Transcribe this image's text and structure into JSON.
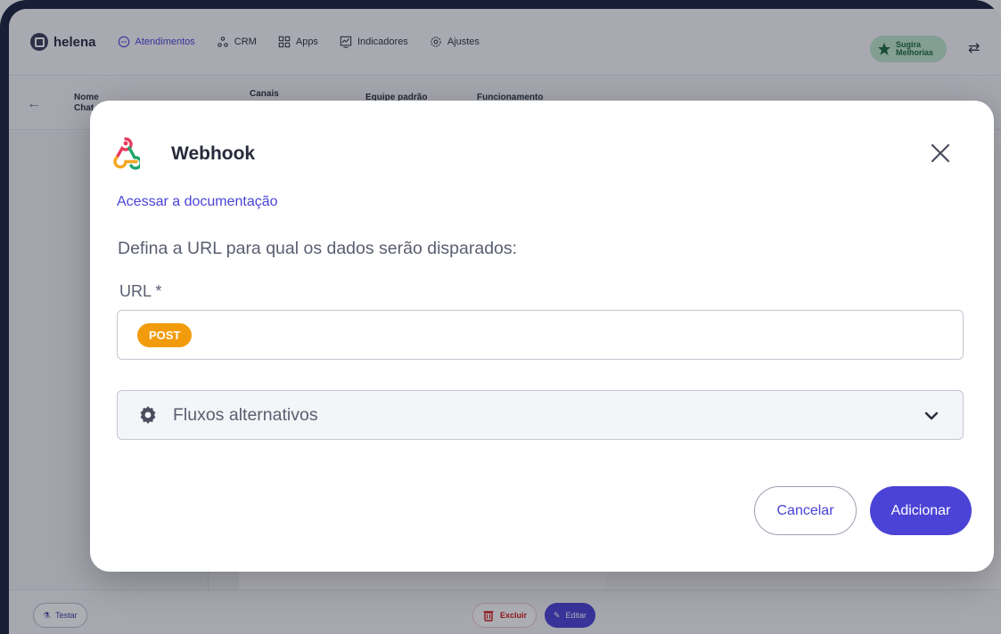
{
  "navbar": {
    "brand": "helena",
    "items": [
      {
        "label": "Atendimentos",
        "icon": "chat-icon",
        "active": true
      },
      {
        "label": "CRM",
        "icon": "crm-nodes-icon",
        "active": false
      },
      {
        "label": "Apps",
        "icon": "grid-icon",
        "active": false
      },
      {
        "label": "Indicadores",
        "icon": "chart-icon",
        "active": false
      },
      {
        "label": "Ajustes",
        "icon": "gear-icon",
        "active": false
      }
    ],
    "suggest_line1": "Sugira",
    "suggest_line2": "Melhorias"
  },
  "background": {
    "columns": [
      "Nome",
      "Canais",
      "Equipe padrão",
      "Funcionamento"
    ],
    "name_sub": "Chat",
    "bottom": {
      "test_label": "Testar",
      "delete_label": "Excluir",
      "edit_label": "Editar"
    }
  },
  "modal": {
    "title": "Webhook",
    "doc_link": "Acessar a documentação",
    "instructions": "Defina a URL para qual os dados serão disparados:",
    "url_label": "URL *",
    "method": "POST",
    "url_value": "",
    "accordion_label": "Fluxos alternativos",
    "cancel_label": "Cancelar",
    "add_label": "Adicionar"
  },
  "colors": {
    "accent": "#4a43d6",
    "method_badge": "#f29b0c",
    "suggest_bg": "#bfe6cc",
    "frame": "#1d2340"
  }
}
